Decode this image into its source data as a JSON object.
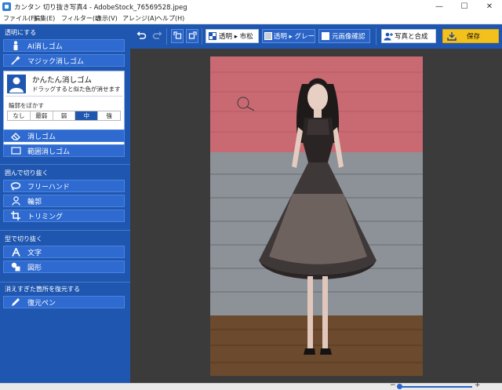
{
  "window": {
    "title": "カンタン 切り抜き写真4 - AdobeStock_76569528.jpeg",
    "minimize": "—",
    "maximize": "☐",
    "close": "✕"
  },
  "menu": [
    "ファイル(F)",
    "編集(E)",
    "フィルター(L)",
    "表示(V)",
    "アレンジ(A)",
    "ヘルプ(H)"
  ],
  "sidebar": {
    "section_transparent": "透明にする",
    "ai_erase": "AI消しゴム",
    "magic_erase": "マジック消しゴム",
    "easy_erase": {
      "title": "かんたん消しゴム",
      "desc": "ドラッグすると似た色が消せます",
      "blur_label": "輪郭をぼかす",
      "options": [
        "なし",
        "最弱",
        "弱",
        "中",
        "強"
      ],
      "selected": "中"
    },
    "eraser": "消しゴム",
    "range_eraser": "範囲消しゴム",
    "section_cut": "囲んで切り抜く",
    "freehand": "フリーハンド",
    "outline": "輪郭",
    "trimming": "トリミング",
    "section_shape": "型で切り抜く",
    "text": "文字",
    "shape": "図形",
    "section_restore": "消えすぎた箇所を復元する",
    "restore_pen": "復元ペン"
  },
  "toolbar": {
    "transparent_check": "透明 ▸ 市松",
    "transparent_gray": "透明 ▸ グレー",
    "original_check": "元画像確認",
    "combine": "写真と合成",
    "save": "保存"
  },
  "colors": {
    "sidebar_bg": "#1e56b0",
    "button_bg": "#2e6ad0",
    "canvas_bg": "#3b3b3b",
    "save_bg": "#f4c11c",
    "wall_red": "#c96a72",
    "wall_gray": "#8a9094",
    "floor_wood": "#6b4a2e"
  }
}
